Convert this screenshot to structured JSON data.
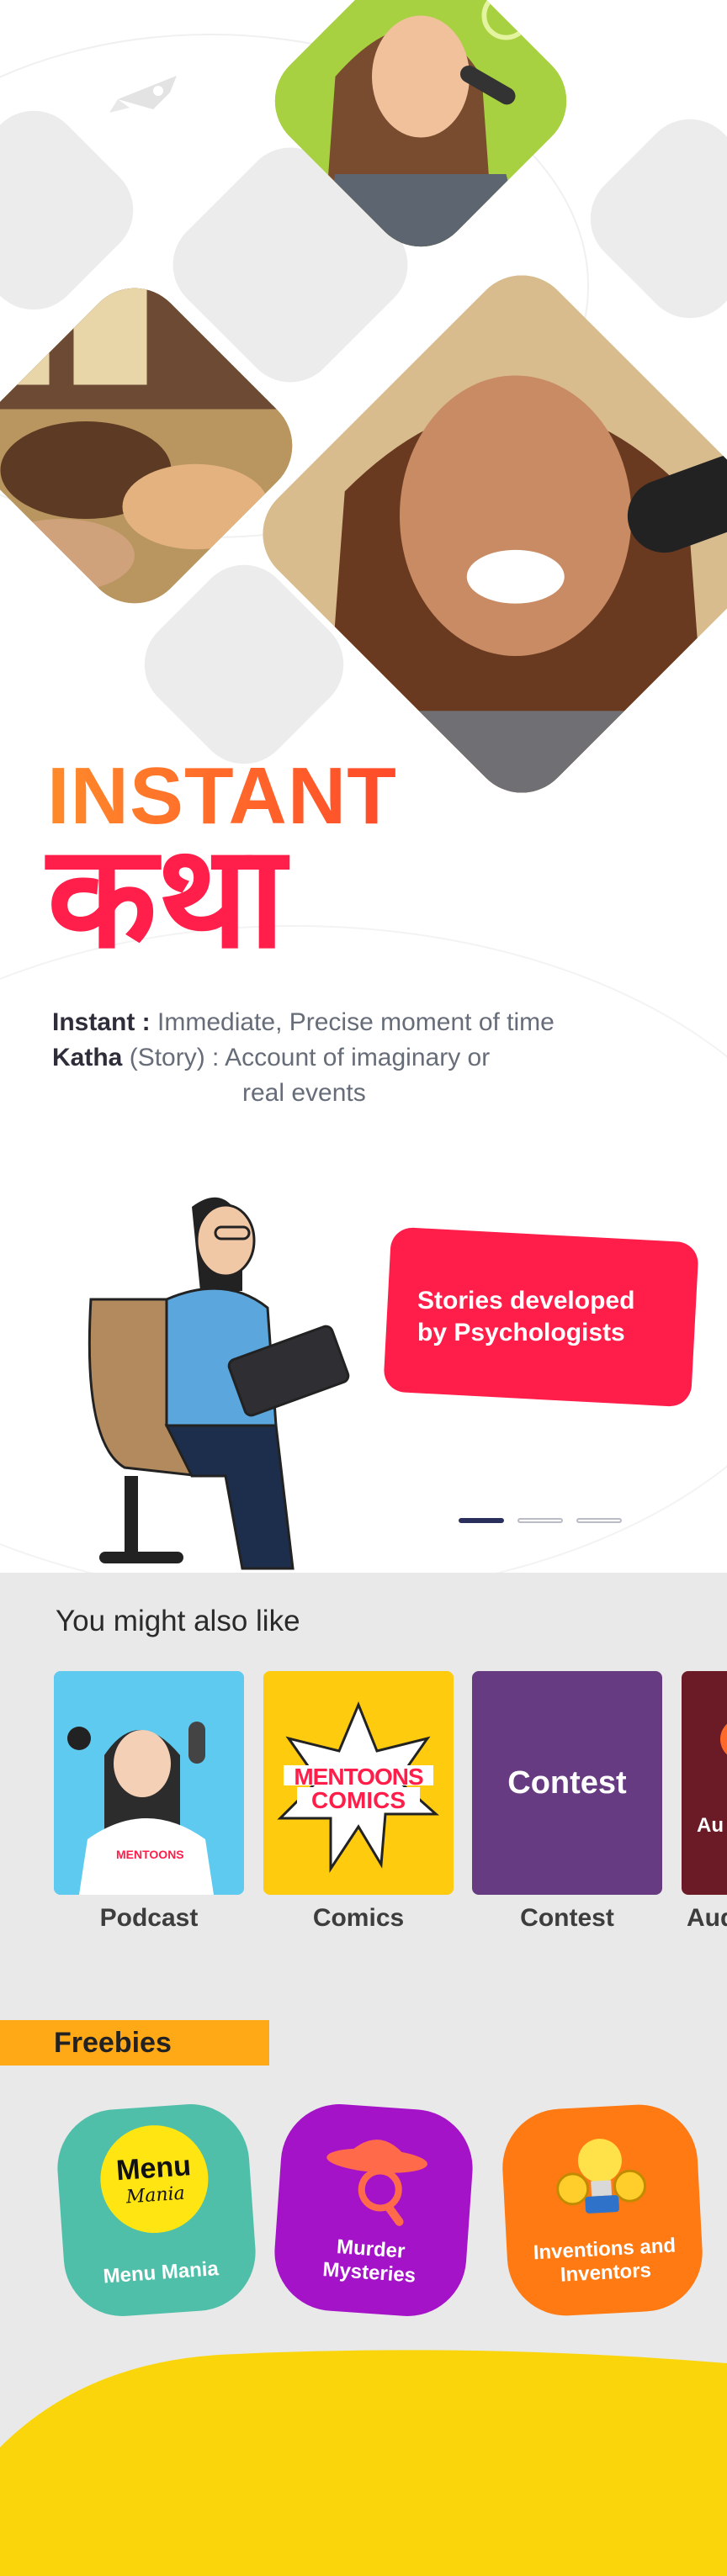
{
  "hero": {
    "title_line1": "INSTANT",
    "title_line2": "कथा",
    "definitions": [
      {
        "term": "Instant :",
        "meaning": "Immediate, Precise moment of time"
      },
      {
        "term": "Katha",
        "term_note": "(Story) :",
        "meaning": "Account of imaginary or",
        "meaning_cont": "real events"
      }
    ]
  },
  "carousel": {
    "caption": "Stories developed by Psychologists",
    "indicator_count": 3,
    "active_index": 0
  },
  "recommendations": {
    "title": "You might also like",
    "items": [
      {
        "label": "Podcast",
        "badge": "MENTOONS"
      },
      {
        "label": "Comics",
        "art_text_1": "MENTOONS",
        "art_text_2": "COMICS"
      },
      {
        "label": "Contest",
        "art_text": "Contest"
      },
      {
        "label": "Aud",
        "art_text": "Au"
      }
    ]
  },
  "freebies": {
    "title": "Freebies",
    "items": [
      {
        "label": "Menu Mania",
        "art_text_1": "Menu",
        "art_text_2": "Mania"
      },
      {
        "label": "Murder Mysteries"
      },
      {
        "label": "Inventions and Inventors"
      }
    ]
  },
  "colors": {
    "accent_red": "#ff1e49",
    "accent_orange": "#ff8a2a",
    "freebies_bar": "#ffa916",
    "contest_purple": "#673b82",
    "audio_maroon": "#6a1b25",
    "menu_teal": "#4fbfa9",
    "murder_purple": "#a513c9",
    "inventions_orange": "#ff7a12",
    "footer_yellow": "#fbd50b"
  }
}
